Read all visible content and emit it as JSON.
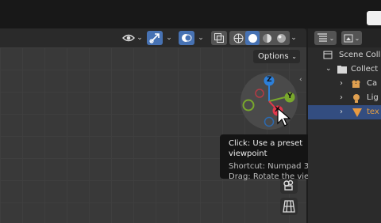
{
  "viewport": {
    "options_label": "Options",
    "header_icons": [
      "visibility-icon",
      "gizmo-toggle-icon",
      "overlay-toggle-icon",
      "xray-icon",
      "wireframe-shading-icon",
      "solid-shading-icon",
      "material-shading-icon",
      "rendered-shading-icon"
    ]
  },
  "gizmo": {
    "z_label": "Z",
    "y_label": "Y",
    "x_label": "X",
    "colors": {
      "x": "#e2394c",
      "y": "#79a82c",
      "z": "#2c7fd9"
    }
  },
  "tooltip": {
    "line1": "Click: Use a preset viewpoint",
    "line2": "Shortcut: Numpad 3",
    "line3": "Drag: Rotate the view"
  },
  "outliner": {
    "items": [
      {
        "label": "Scene Colle",
        "icon": "scene-collection-icon"
      },
      {
        "label": "Collect",
        "icon": "collection-icon"
      },
      {
        "label": "Ca",
        "icon": "camera-icon"
      },
      {
        "label": "Lig",
        "icon": "light-icon"
      },
      {
        "label": "tex",
        "icon": "mesh-icon",
        "selected": true
      }
    ]
  },
  "accent": "#4772b3"
}
